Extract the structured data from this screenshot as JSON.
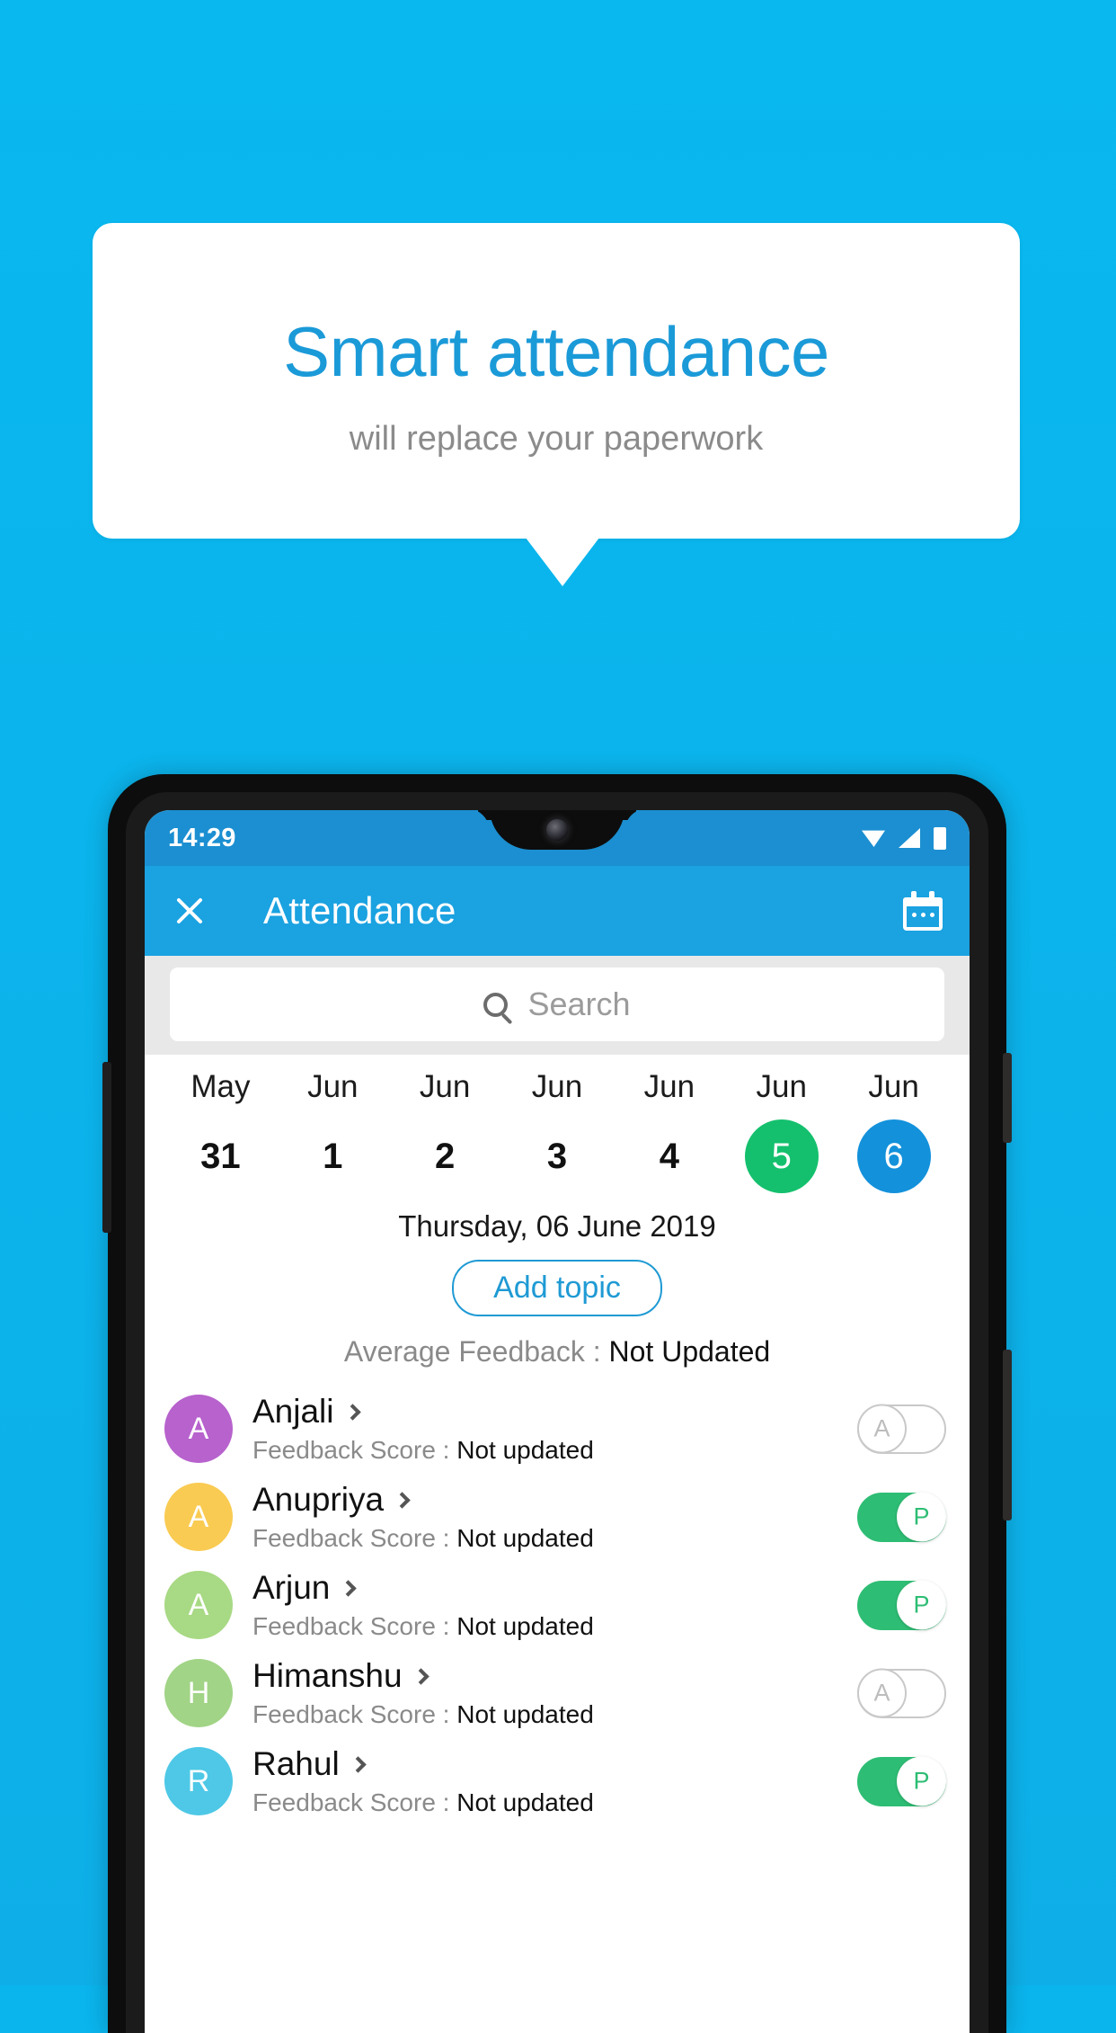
{
  "promo": {
    "title": "Smart attendance",
    "subtitle": "will replace your paperwork",
    "accent_color": "#1b9ad8",
    "background_color": "#0ab4ec"
  },
  "status_bar": {
    "time": "14:29",
    "icons": [
      "wifi-icon",
      "signal-icon",
      "battery-icon"
    ]
  },
  "app_bar": {
    "close_label": "close-icon",
    "title": "Attendance",
    "calendar_label": "calendar-icon",
    "background_color": "#1aa2e1"
  },
  "search": {
    "placeholder": "Search",
    "value": "",
    "icon": "search-icon"
  },
  "date_strip": {
    "days": [
      {
        "month": "May",
        "day": "31",
        "state": "normal"
      },
      {
        "month": "Jun",
        "day": "1",
        "state": "normal"
      },
      {
        "month": "Jun",
        "day": "2",
        "state": "normal"
      },
      {
        "month": "Jun",
        "day": "3",
        "state": "normal"
      },
      {
        "month": "Jun",
        "day": "4",
        "state": "normal"
      },
      {
        "month": "Jun",
        "day": "5",
        "state": "today"
      },
      {
        "month": "Jun",
        "day": "6",
        "state": "selected"
      }
    ],
    "today_color": "#14c06d",
    "selected_color": "#1391db"
  },
  "selected_date_label": "Thursday, 06 June 2019",
  "add_topic_button": "Add topic",
  "average_feedback": {
    "label": "Average Feedback : ",
    "value": "Not Updated"
  },
  "students": [
    {
      "initial": "A",
      "name": "Anjali",
      "avatar_color": "#b762cd",
      "feedback_label": "Feedback Score : ",
      "feedback_value": "Not updated",
      "attendance": "A",
      "present": false
    },
    {
      "initial": "A",
      "name": "Anupriya",
      "avatar_color": "#f9cb52",
      "feedback_label": "Feedback Score : ",
      "feedback_value": "Not updated",
      "attendance": "P",
      "present": true
    },
    {
      "initial": "A",
      "name": "Arjun",
      "avatar_color": "#a8d984",
      "feedback_label": "Feedback Score : ",
      "feedback_value": "Not updated",
      "attendance": "P",
      "present": true
    },
    {
      "initial": "H",
      "name": "Himanshu",
      "avatar_color": "#a1d486",
      "feedback_label": "Feedback Score : ",
      "feedback_value": "Not updated",
      "attendance": "A",
      "present": false
    },
    {
      "initial": "R",
      "name": "Rahul",
      "avatar_color": "#4ec8e6",
      "feedback_label": "Feedback Score : ",
      "feedback_value": "Not updated",
      "attendance": "P",
      "present": true
    }
  ]
}
